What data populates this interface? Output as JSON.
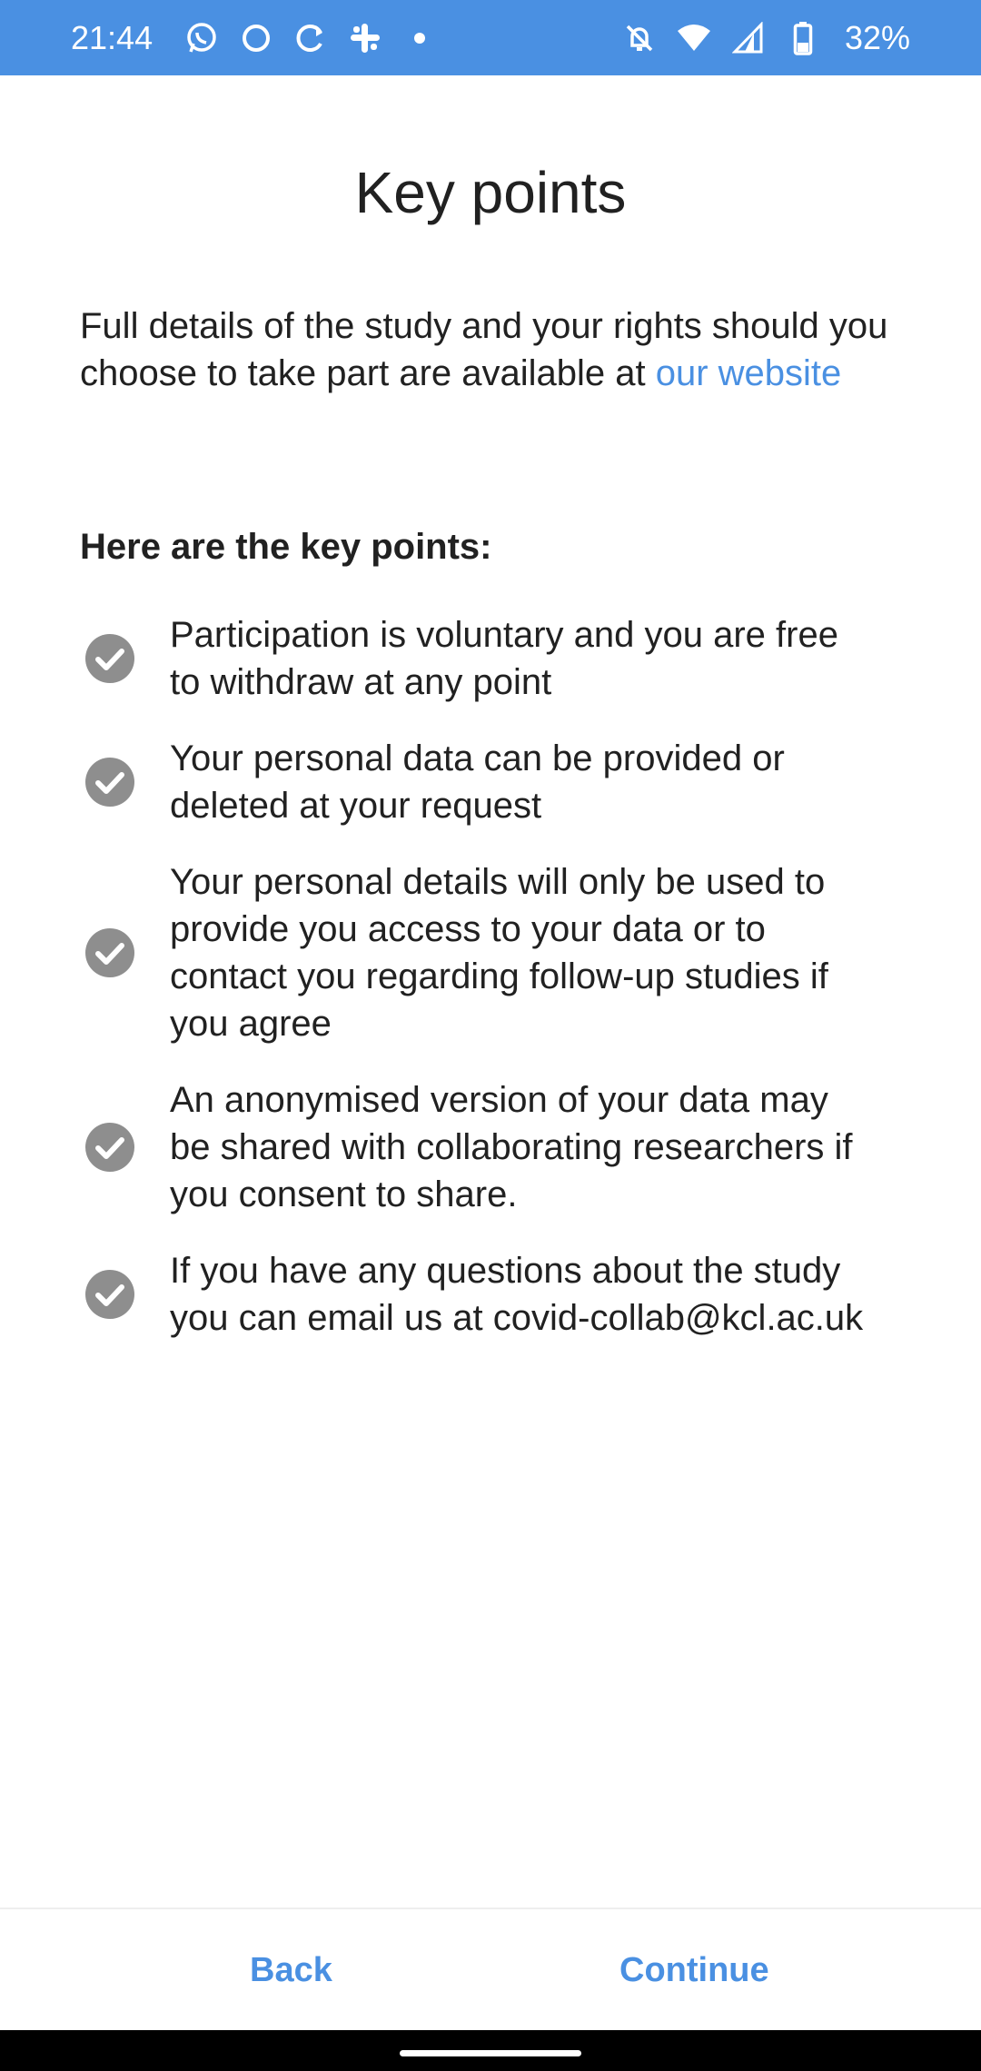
{
  "status_bar": {
    "time": "21:44",
    "battery": "32%",
    "icons": [
      "whatsapp-icon",
      "circle-app-icon",
      "sync-icon",
      "slack-icon",
      "dot-icon",
      "mute-icon",
      "wifi-icon",
      "signal-icon",
      "battery-icon"
    ],
    "background_color": "#4a90e2"
  },
  "page": {
    "title": "Key points",
    "intro_text": "Full details of the study and your rights should you choose to take part are available at ",
    "intro_link": "our website",
    "subheading": "Here are the key points:",
    "points": [
      "Participation is voluntary and you are free to withdraw at any point",
      "Your personal data can be provided or deleted at your request",
      "Your personal details will only be used to provide you access to your data or to contact you regarding follow-up studies if you agree",
      "An anonymised version of your data may be shared with collaborating researchers if you consent to share.",
      "If you have any questions about the study you can email us at covid-collab@kcl.ac.uk"
    ]
  },
  "footer": {
    "back_label": "Back",
    "continue_label": "Continue"
  },
  "colors": {
    "accent": "#4a90e2",
    "check_circle": "#8e8e8e",
    "text": "#212121"
  }
}
